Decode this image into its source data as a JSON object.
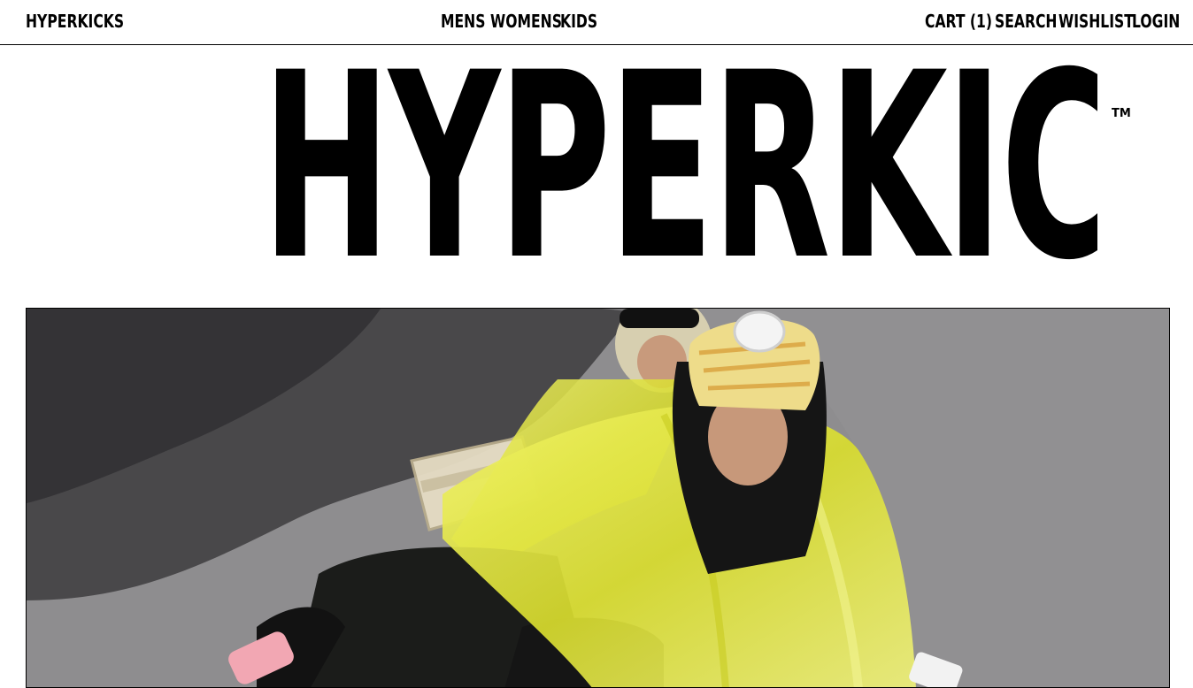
{
  "header": {
    "brand": "HYPERKICKS",
    "nav": {
      "mens": "MENS",
      "womens": "WOMENS",
      "kids": "KIDS"
    },
    "utility": {
      "cart": "CART (1)",
      "search": "SEARCH",
      "wishlist": "WISHLIST",
      "login": "LOGIN"
    }
  },
  "hero": {
    "logo_text": "HYPERKICKS",
    "trademark": "TM"
  },
  "colors": {
    "background": "#ffffff",
    "text": "#000000",
    "raincoat": "#e5e93a",
    "asphalt": "#8d8c8e"
  }
}
